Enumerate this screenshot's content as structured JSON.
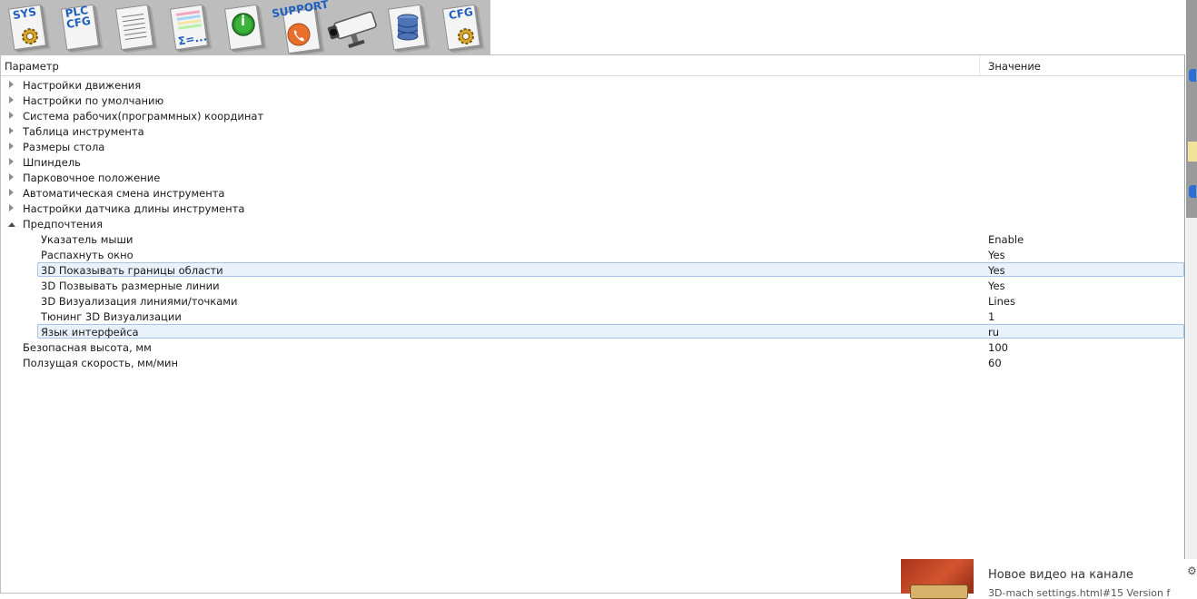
{
  "toolbar": {
    "items": [
      {
        "name": "sys-config-button",
        "label": "SYS"
      },
      {
        "name": "plc-config-button",
        "label": "PLC\nCFG"
      },
      {
        "name": "report-button",
        "label": ""
      },
      {
        "name": "formula-button",
        "label": "Σ=..."
      },
      {
        "name": "info-button",
        "label": "i"
      },
      {
        "name": "support-button",
        "label": "SUPPORT"
      },
      {
        "name": "camera-button",
        "label": ""
      },
      {
        "name": "database-button",
        "label": ""
      },
      {
        "name": "cfg-button",
        "label": "CFG"
      }
    ]
  },
  "grid": {
    "col_param": "Параметр",
    "col_value": "Значение",
    "rows": [
      {
        "label": "Настройки движения",
        "value": "",
        "level": 0,
        "expander": "collapsed"
      },
      {
        "label": "Настройки по умолчанию",
        "value": "",
        "level": 0,
        "expander": "collapsed"
      },
      {
        "label": "Система рабочих(программных) координат",
        "value": "",
        "level": 0,
        "expander": "collapsed"
      },
      {
        "label": "Таблица инструмента",
        "value": "",
        "level": 0,
        "expander": "collapsed"
      },
      {
        "label": "Размеры стола",
        "value": "",
        "level": 0,
        "expander": "collapsed"
      },
      {
        "label": "Шпиндель",
        "value": "",
        "level": 0,
        "expander": "collapsed"
      },
      {
        "label": "Парковочное положение",
        "value": "",
        "level": 0,
        "expander": "collapsed"
      },
      {
        "label": "Автоматическая смена инструмента",
        "value": "",
        "level": 0,
        "expander": "collapsed"
      },
      {
        "label": "Настройки датчика длины инструмента",
        "value": "",
        "level": 0,
        "expander": "collapsed"
      },
      {
        "label": "Предпочтения",
        "value": "",
        "level": 0,
        "expander": "expanded"
      },
      {
        "label": "Указатель мыши",
        "value": "Enable",
        "level": 1,
        "expander": "none"
      },
      {
        "label": "Распахнуть окно",
        "value": "Yes",
        "level": 1,
        "expander": "none"
      },
      {
        "label": "3D Показывать границы области",
        "value": "Yes",
        "level": 1,
        "expander": "none",
        "selected": true
      },
      {
        "label": "3D Позвывать размерные линии",
        "value": "Yes",
        "level": 1,
        "expander": "none"
      },
      {
        "label": "3D Визуализация линиями/точками",
        "value": "Lines",
        "level": 1,
        "expander": "none"
      },
      {
        "label": "Тюнинг 3D Визуализации",
        "value": "1",
        "level": 1,
        "expander": "none"
      },
      {
        "label": "Язык интерфейса",
        "value": "ru",
        "level": 1,
        "expander": "none",
        "selected": true
      },
      {
        "label": "Безопасная высота, мм",
        "value": "100",
        "level": 0,
        "expander": "none"
      },
      {
        "label": "Ползущая скорость, мм/мин",
        "value": "60",
        "level": 0,
        "expander": "none"
      }
    ]
  },
  "notification": {
    "title": "Новое видео на канале",
    "subtitle": "3D-mach settings.html#15 Version f"
  }
}
